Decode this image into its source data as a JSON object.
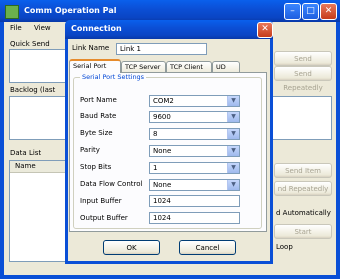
{
  "main_window": {
    "title": "Comm Operation Pal",
    "menu": [
      "File",
      "View"
    ],
    "quick_send_label": "Quick Send",
    "backlog_label": "Backlog (last",
    "data_list_label": "Data List",
    "list_header_name": "Name",
    "buttons": {
      "send": "Send",
      "send_repeatedly": "Send Repeatedly",
      "send_item": "Send Item",
      "send_repeatedly_2": "nd Repeatedly",
      "start": "Start"
    },
    "auto_label": "d Automatically",
    "loop_label": "Loop"
  },
  "dialog": {
    "title": "Connection",
    "close_glyph": "✕",
    "link_name_label": "Link Name",
    "link_name_value": "Link 1",
    "tabs": [
      "Serial Port",
      "TCP Server",
      "TCP Client",
      "UD"
    ],
    "group_label": "Serial Port Settings",
    "fields": [
      {
        "label": "Port Name",
        "value": "COM2"
      },
      {
        "label": "Baud Rate",
        "value": "9600"
      },
      {
        "label": "Byte Size",
        "value": "8"
      },
      {
        "label": "Parity",
        "value": "None"
      },
      {
        "label": "Stop Bits",
        "value": "1"
      },
      {
        "label": "Data Flow Control",
        "value": "None"
      },
      {
        "label": "Input Buffer",
        "value": "1024"
      },
      {
        "label": "Output Buffer",
        "value": "1024"
      }
    ],
    "ok": "OK",
    "cancel": "Cancel"
  },
  "colors": {
    "title_blue": "#0a4fd6",
    "close_red": "#c63b1a",
    "tab_accent": "#e68b2c",
    "group_label": "#0046d5"
  }
}
